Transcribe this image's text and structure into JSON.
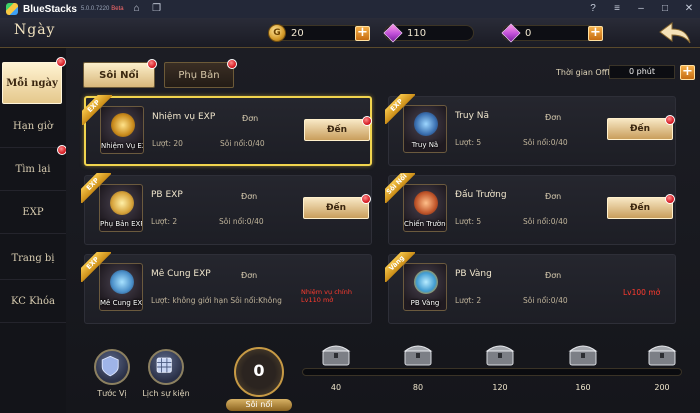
{
  "bluestacks": {
    "name": "BlueStacks",
    "version": "5.0.0.7220",
    "channel": "Beta"
  },
  "header": {
    "title": "Ngày",
    "gold": "20",
    "diamond_locked": "110",
    "diamond": "0"
  },
  "sidebar": {
    "items": [
      {
        "label": "Mỗi ngày",
        "active": true,
        "dot": true
      },
      {
        "label": "Hạn giờ",
        "active": false,
        "dot": false
      },
      {
        "label": "Tìm lại",
        "active": false,
        "dot": true
      },
      {
        "label": "EXP",
        "active": false,
        "dot": false
      },
      {
        "label": "Trang bị",
        "active": false,
        "dot": false
      },
      {
        "label": "KC Khóa",
        "active": false,
        "dot": false
      }
    ]
  },
  "tabs": {
    "active": "Sôi Nổi",
    "inactive": "Phụ Bản"
  },
  "offline": {
    "label": "Thời gian Offline:",
    "value": "0 phút"
  },
  "quests": [
    {
      "ribbon": "EXP",
      "icon_caption": "Nhiệm Vụ EXP",
      "name": "Nhiệm vụ EXP",
      "type": "Đơn",
      "turns": "Lượt: 20",
      "power": "Sôi nổi:0/40",
      "button": "Đến",
      "requirement": ""
    },
    {
      "ribbon": "EXP",
      "icon_caption": "Truy Nã",
      "name": "Truy Nã",
      "type": "Đơn",
      "turns": "Lượt: 5",
      "power": "Sôi nổi:0/40",
      "button": "Đến",
      "requirement": ""
    },
    {
      "ribbon": "EXP",
      "icon_caption": "Phụ Bản EXP",
      "name": "PB EXP",
      "type": "Đơn",
      "turns": "Lượt: 2",
      "power": "Sôi nổi:0/40",
      "button": "Đến",
      "requirement": ""
    },
    {
      "ribbon": "Sôi Nổi",
      "icon_caption": "Chiến Trường",
      "name": "Đấu Trường",
      "type": "Đơn",
      "turns": "Lượt: 5",
      "power": "Sôi nổi:0/40",
      "button": "Đến",
      "requirement": ""
    },
    {
      "ribbon": "EXP",
      "icon_caption": "Mê Cung EXP",
      "name": "Mê Cung EXP",
      "type": "Đơn",
      "turns": "Lượt: không giới hạn Sôi nổi:Không",
      "power": "",
      "button": "",
      "requirement": "Nhiệm vụ chính Lv110 mở"
    },
    {
      "ribbon": "Vàng",
      "icon_caption": "PB Vàng",
      "name": "PB Vàng",
      "type": "Đơn",
      "turns": "Lượt: 2",
      "power": "Sôi nổi:0/40",
      "button": "",
      "requirement": "Lv100 mở"
    }
  ],
  "bottom": {
    "rank_label": "Tước Vị",
    "history_label": "Lịch sự kiện",
    "activity_value": "0",
    "activity_label": "Sôi nổi",
    "progress": 0,
    "milestones": [
      "40",
      "80",
      "120",
      "160",
      "200"
    ]
  },
  "colors": {
    "accent_gold": "#f1d44e",
    "red_text": "#ff3b2e",
    "button_cream": "#f7e7c4"
  }
}
